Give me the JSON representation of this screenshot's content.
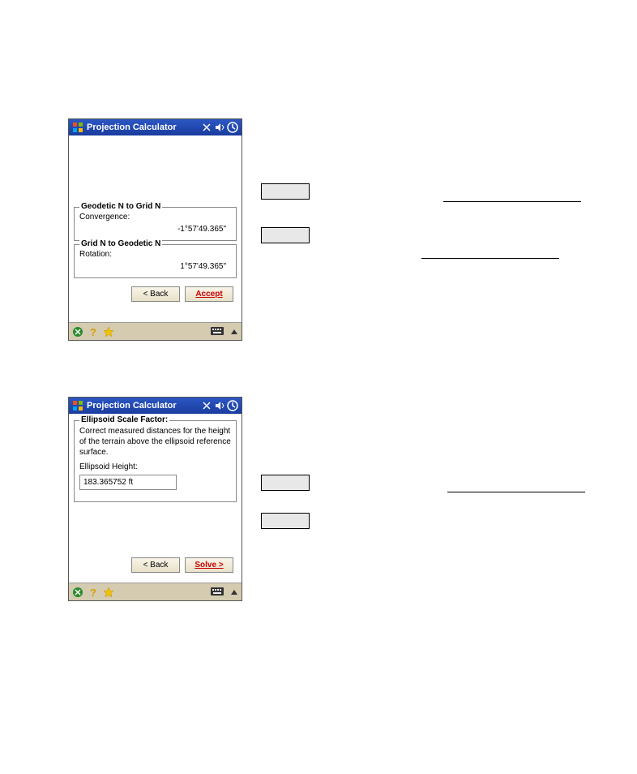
{
  "window1": {
    "title": "Projection Calculator",
    "group1": {
      "legend": "Geodetic N to Grid N",
      "label": "Convergence:",
      "value": "-1°57'49.365\""
    },
    "group2": {
      "legend": "Grid N to Geodetic N",
      "label": "Rotation:",
      "value": "1°57'49.365\""
    },
    "buttons": {
      "back": "< Back",
      "accept": "Accept"
    }
  },
  "window2": {
    "title": "Projection Calculator",
    "group": {
      "legend": "Ellipsoid Scale Factor:",
      "desc": "Correct measured distances for the height of the terrain above the ellipsoid reference surface.",
      "label": "Ellipsoid Height:",
      "value": "183.365752 ft"
    },
    "buttons": {
      "back": "< Back",
      "solve": "Solve >"
    }
  }
}
